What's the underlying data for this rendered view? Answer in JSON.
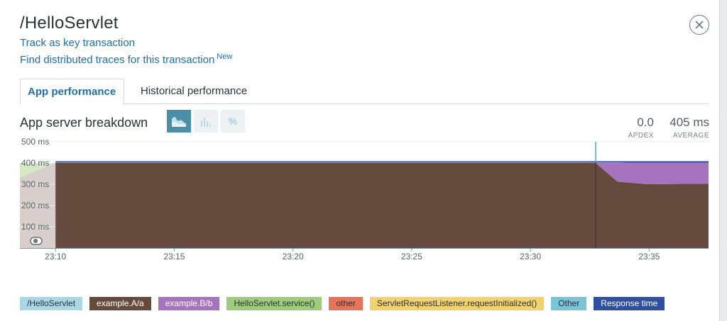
{
  "header": {
    "title": "/HelloServlet",
    "track_link": "Track as key transaction",
    "traces_link": "Find distributed traces for this transaction",
    "new_badge": "New"
  },
  "tabs": [
    {
      "label": "App performance",
      "active": true
    },
    {
      "label": "Historical performance",
      "active": false
    }
  ],
  "breakdown": {
    "title": "App server breakdown",
    "percent_label": "%",
    "apdex": {
      "value": "0.0",
      "label": "APDEX"
    },
    "average": {
      "value": "405 ms",
      "label": "AVERAGE"
    }
  },
  "chart_data": {
    "type": "area",
    "x_ticks": [
      "23:10",
      "23:15",
      "23:20",
      "23:25",
      "23:30",
      "23:35"
    ],
    "y_ticks": [
      "500 ms",
      "400 ms",
      "300 ms",
      "200 ms",
      "100 ms"
    ],
    "ylim": [
      0,
      500
    ],
    "xlim_minutes": [
      "23:08:30",
      "23:37:30"
    ],
    "series": [
      {
        "name": "example.A/a",
        "color": "#654b3e",
        "points": [
          [
            "23:10",
            400
          ],
          [
            "23:32:45",
            400
          ],
          [
            "23:33:40",
            312
          ],
          [
            "23:35",
            300
          ],
          [
            "23:37:30",
            303
          ]
        ]
      },
      {
        "name": "example.B/b",
        "color": "#a674be",
        "points": [
          [
            "23:10",
            0
          ],
          [
            "23:32:45",
            0
          ],
          [
            "23:33:40",
            88
          ],
          [
            "23:35",
            105
          ],
          [
            "23:37:30",
            102
          ]
        ]
      },
      {
        "name": "Response time",
        "color": "#2f4fa0",
        "points": [
          [
            "23:10",
            405
          ],
          [
            "23:37:30",
            405
          ]
        ]
      }
    ],
    "marker_time": "23:32:45",
    "legend": [
      {
        "label": "/HelloServlet",
        "color": "#a8d8e8",
        "text_color": "#2a3338"
      },
      {
        "label": "example.A/a",
        "color": "#654b3e",
        "text_color": "#ffffff"
      },
      {
        "label": "example.B/b",
        "color": "#a674be",
        "text_color": "#ffffff"
      },
      {
        "label": "HelloServlet.service()",
        "color": "#9fcc7a",
        "text_color": "#2a3338"
      },
      {
        "label": "other",
        "color": "#e6735a",
        "text_color": "#2a3338"
      },
      {
        "label": "ServletRequestListener.requestInitialized()",
        "color": "#f2d26c",
        "text_color": "#2a3338"
      },
      {
        "label": "Other",
        "color": "#79c4d8",
        "text_color": "#2a3338"
      },
      {
        "label": "Response time",
        "color": "#2f4fa0",
        "text_color": "#ffffff"
      }
    ]
  },
  "icons": {
    "close": "close-icon",
    "area": "area-chart-icon",
    "histogram": "histogram-icon",
    "toggle": "toggle-icon"
  }
}
